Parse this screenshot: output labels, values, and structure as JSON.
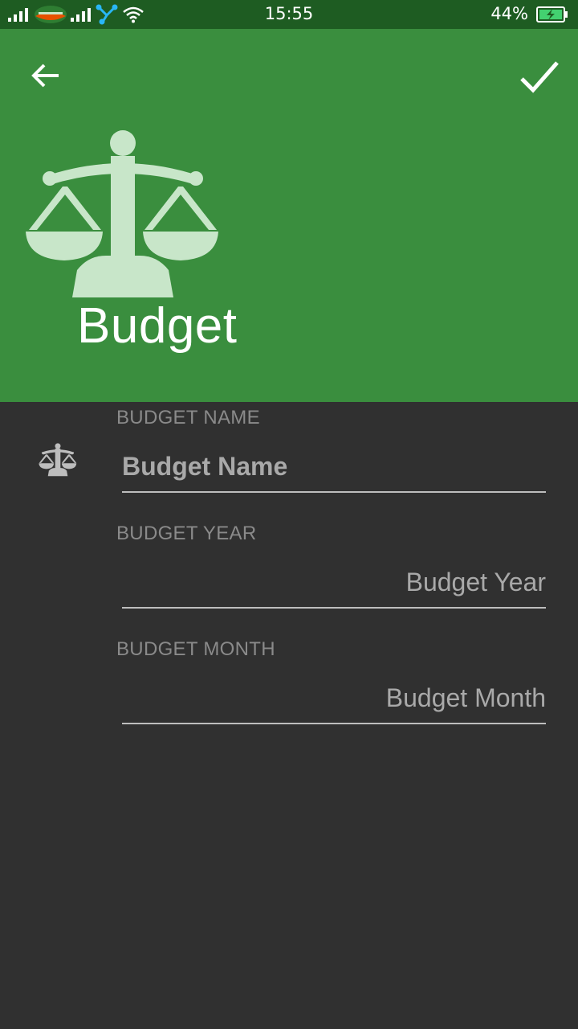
{
  "status_bar": {
    "time": "15:55",
    "battery_percent": "44%",
    "icons": [
      "signal-icon",
      "carrier-logo-icon",
      "signal-icon",
      "share-icon",
      "wifi-icon",
      "battery-charging-icon"
    ],
    "colors": {
      "background": "#1e5c22"
    }
  },
  "header": {
    "back_icon": "arrow-left-icon",
    "done_icon": "checkmark-icon",
    "hero_icon": "balance-scale-icon",
    "title": "Budget",
    "colors": {
      "background": "#3a8e3e",
      "icon": "#c8e6c9"
    }
  },
  "form": {
    "background": "#303030",
    "fields": [
      {
        "label": "BUDGET NAME",
        "placeholder": "Budget Name",
        "icon": "balance-scale-icon"
      },
      {
        "label": "BUDGET YEAR",
        "placeholder": "Budget Year"
      },
      {
        "label": "BUDGET MONTH",
        "placeholder": "Budget Month"
      }
    ]
  }
}
